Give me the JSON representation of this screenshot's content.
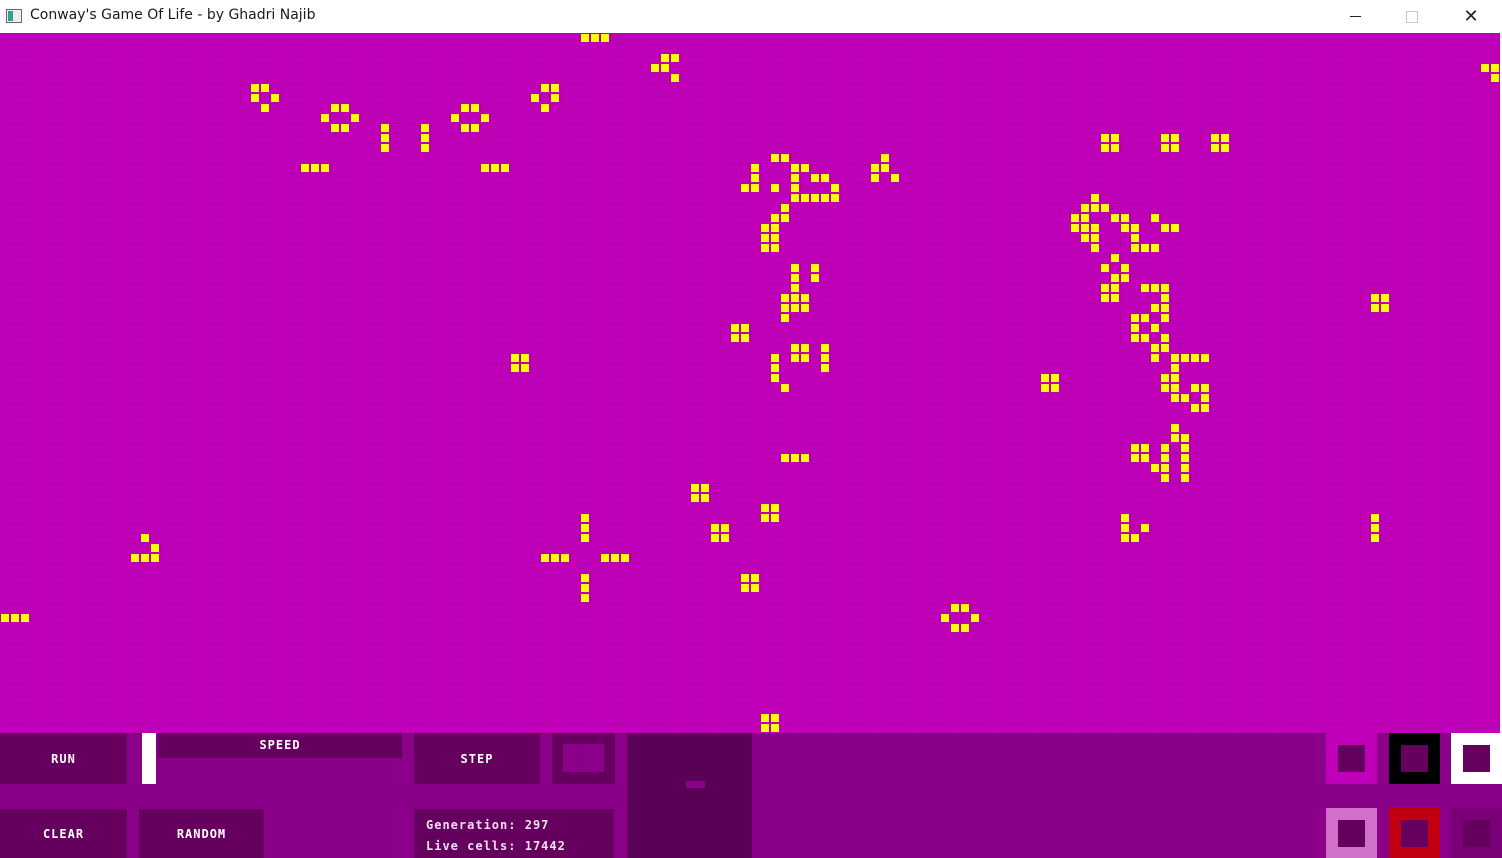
{
  "window": {
    "title": "Conway's Game Of Life - by Ghadri Najib",
    "icon": "app-window-icon",
    "controls": {
      "minimize": "minimize-icon",
      "maximize": "maximize-icon",
      "close": "close-icon"
    }
  },
  "colors": {
    "board_background": "#c000b8",
    "grid_line": "#b400ac",
    "live_cell": "#ffff00",
    "panel_background": "#8a0088",
    "button_background": "#66005e",
    "button_text": "#ffffff"
  },
  "board": {
    "cols": 150,
    "rows": 70,
    "live_cells": [
      [
        0,
        58
      ],
      [
        0,
        59
      ],
      [
        0,
        60
      ],
      [
        3,
        148
      ],
      [
        3,
        149
      ],
      [
        4,
        149
      ],
      [
        2,
        66
      ],
      [
        2,
        67
      ],
      [
        3,
        65
      ],
      [
        3,
        66
      ],
      [
        4,
        67
      ],
      [
        5,
        25
      ],
      [
        5,
        26
      ],
      [
        6,
        25
      ],
      [
        6,
        27
      ],
      [
        7,
        26
      ],
      [
        5,
        54
      ],
      [
        5,
        55
      ],
      [
        6,
        53
      ],
      [
        6,
        55
      ],
      [
        7,
        54
      ],
      [
        7,
        33
      ],
      [
        7,
        34
      ],
      [
        8,
        32
      ],
      [
        8,
        35
      ],
      [
        9,
        33
      ],
      [
        9,
        34
      ],
      [
        7,
        46
      ],
      [
        7,
        47
      ],
      [
        8,
        45
      ],
      [
        8,
        48
      ],
      [
        9,
        46
      ],
      [
        9,
        47
      ],
      [
        9,
        38
      ],
      [
        10,
        38
      ],
      [
        11,
        38
      ],
      [
        9,
        42
      ],
      [
        10,
        42
      ],
      [
        11,
        42
      ],
      [
        13,
        30
      ],
      [
        13,
        31
      ],
      [
        13,
        32
      ],
      [
        13,
        48
      ],
      [
        13,
        49
      ],
      [
        13,
        50
      ],
      [
        10,
        110
      ],
      [
        10,
        111
      ],
      [
        11,
        110
      ],
      [
        11,
        111
      ],
      [
        10,
        116
      ],
      [
        10,
        117
      ],
      [
        11,
        116
      ],
      [
        11,
        117
      ],
      [
        10,
        121
      ],
      [
        10,
        122
      ],
      [
        11,
        121
      ],
      [
        11,
        122
      ],
      [
        12,
        77
      ],
      [
        12,
        78
      ],
      [
        13,
        75
      ],
      [
        13,
        79
      ],
      [
        13,
        80
      ],
      [
        14,
        75
      ],
      [
        14,
        79
      ],
      [
        14,
        81
      ],
      [
        14,
        82
      ],
      [
        15,
        74
      ],
      [
        15,
        75
      ],
      [
        15,
        77
      ],
      [
        15,
        79
      ],
      [
        15,
        83
      ],
      [
        16,
        79
      ],
      [
        16,
        80
      ],
      [
        16,
        81
      ],
      [
        16,
        82
      ],
      [
        16,
        83
      ],
      [
        17,
        78
      ],
      [
        18,
        77
      ],
      [
        18,
        78
      ],
      [
        19,
        76
      ],
      [
        19,
        77
      ],
      [
        20,
        76
      ],
      [
        20,
        77
      ],
      [
        21,
        76
      ],
      [
        21,
        77
      ],
      [
        12,
        88
      ],
      [
        13,
        87
      ],
      [
        13,
        88
      ],
      [
        14,
        87
      ],
      [
        14,
        89
      ],
      [
        16,
        109
      ],
      [
        17,
        108
      ],
      [
        17,
        109
      ],
      [
        17,
        110
      ],
      [
        18,
        107
      ],
      [
        18,
        108
      ],
      [
        18,
        111
      ],
      [
        18,
        112
      ],
      [
        18,
        115
      ],
      [
        19,
        107
      ],
      [
        19,
        108
      ],
      [
        19,
        109
      ],
      [
        19,
        112
      ],
      [
        19,
        113
      ],
      [
        19,
        116
      ],
      [
        19,
        117
      ],
      [
        20,
        108
      ],
      [
        20,
        109
      ],
      [
        20,
        113
      ],
      [
        21,
        109
      ],
      [
        21,
        113
      ],
      [
        21,
        114
      ],
      [
        21,
        115
      ],
      [
        22,
        111
      ],
      [
        23,
        110
      ],
      [
        23,
        112
      ],
      [
        24,
        111
      ],
      [
        24,
        112
      ],
      [
        25,
        110
      ],
      [
        25,
        111
      ],
      [
        25,
        114
      ],
      [
        25,
        115
      ],
      [
        25,
        116
      ],
      [
        26,
        110
      ],
      [
        26,
        111
      ],
      [
        26,
        116
      ],
      [
        27,
        115
      ],
      [
        27,
        116
      ],
      [
        28,
        113
      ],
      [
        28,
        114
      ],
      [
        28,
        116
      ],
      [
        29,
        113
      ],
      [
        29,
        115
      ],
      [
        30,
        113
      ],
      [
        30,
        114
      ],
      [
        30,
        116
      ],
      [
        31,
        115
      ],
      [
        31,
        116
      ],
      [
        32,
        115
      ],
      [
        32,
        117
      ],
      [
        32,
        118
      ],
      [
        32,
        119
      ],
      [
        32,
        120
      ],
      [
        33,
        117
      ],
      [
        34,
        116
      ],
      [
        34,
        117
      ],
      [
        35,
        116
      ],
      [
        35,
        117
      ],
      [
        35,
        119
      ],
      [
        35,
        120
      ],
      [
        36,
        117
      ],
      [
        36,
        118
      ],
      [
        36,
        120
      ],
      [
        37,
        119
      ],
      [
        37,
        120
      ],
      [
        23,
        79
      ],
      [
        23,
        81
      ],
      [
        24,
        79
      ],
      [
        24,
        81
      ],
      [
        25,
        79
      ],
      [
        26,
        78
      ],
      [
        26,
        79
      ],
      [
        26,
        80
      ],
      [
        27,
        78
      ],
      [
        27,
        79
      ],
      [
        27,
        80
      ],
      [
        28,
        78
      ],
      [
        26,
        137
      ],
      [
        26,
        138
      ],
      [
        27,
        137
      ],
      [
        27,
        138
      ],
      [
        29,
        73
      ],
      [
        29,
        74
      ],
      [
        30,
        73
      ],
      [
        30,
        74
      ],
      [
        31,
        79
      ],
      [
        31,
        80
      ],
      [
        31,
        82
      ],
      [
        32,
        77
      ],
      [
        32,
        79
      ],
      [
        32,
        80
      ],
      [
        32,
        82
      ],
      [
        33,
        77
      ],
      [
        33,
        82
      ],
      [
        34,
        77
      ],
      [
        35,
        78
      ],
      [
        32,
        51
      ],
      [
        32,
        52
      ],
      [
        33,
        51
      ],
      [
        33,
        52
      ],
      [
        34,
        104
      ],
      [
        34,
        105
      ],
      [
        35,
        104
      ],
      [
        35,
        105
      ],
      [
        39,
        117
      ],
      [
        40,
        117
      ],
      [
        40,
        118
      ],
      [
        41,
        113
      ],
      [
        41,
        114
      ],
      [
        41,
        116
      ],
      [
        41,
        118
      ],
      [
        42,
        113
      ],
      [
        42,
        114
      ],
      [
        42,
        116
      ],
      [
        42,
        118
      ],
      [
        43,
        115
      ],
      [
        43,
        116
      ],
      [
        43,
        118
      ],
      [
        44,
        116
      ],
      [
        44,
        118
      ],
      [
        42,
        78
      ],
      [
        42,
        79
      ],
      [
        42,
        80
      ],
      [
        45,
        69
      ],
      [
        45,
        70
      ],
      [
        46,
        69
      ],
      [
        46,
        70
      ],
      [
        47,
        76
      ],
      [
        47,
        77
      ],
      [
        48,
        76
      ],
      [
        48,
        77
      ],
      [
        48,
        112
      ],
      [
        49,
        112
      ],
      [
        49,
        114
      ],
      [
        50,
        112
      ],
      [
        50,
        113
      ],
      [
        48,
        137
      ],
      [
        49,
        137
      ],
      [
        50,
        137
      ],
      [
        48,
        58
      ],
      [
        49,
        58
      ],
      [
        50,
        58
      ],
      [
        49,
        71
      ],
      [
        49,
        72
      ],
      [
        50,
        71
      ],
      [
        50,
        72
      ],
      [
        50,
        14
      ],
      [
        51,
        15
      ],
      [
        52,
        13
      ],
      [
        52,
        14
      ],
      [
        52,
        15
      ],
      [
        52,
        54
      ],
      [
        52,
        55
      ],
      [
        52,
        56
      ],
      [
        52,
        60
      ],
      [
        52,
        61
      ],
      [
        52,
        62
      ],
      [
        54,
        58
      ],
      [
        55,
        58
      ],
      [
        56,
        58
      ],
      [
        54,
        74
      ],
      [
        54,
        75
      ],
      [
        55,
        74
      ],
      [
        55,
        75
      ],
      [
        57,
        95
      ],
      [
        57,
        96
      ],
      [
        58,
        94
      ],
      [
        58,
        97
      ],
      [
        59,
        95
      ],
      [
        59,
        96
      ],
      [
        58,
        0
      ],
      [
        58,
        1
      ],
      [
        58,
        2
      ],
      [
        68,
        76
      ],
      [
        68,
        77
      ],
      [
        69,
        76
      ],
      [
        69,
        77
      ]
    ]
  },
  "controls": {
    "run": "RUN",
    "speed": "SPEED",
    "step": "STEP",
    "clear": "CLEAR",
    "random": "RANDOM"
  },
  "stats": {
    "generation_label": "Generation:",
    "generation": "297",
    "live_cells_label": "Live cells:",
    "live_cells": "17442"
  },
  "palettes": [
    {
      "name": "palette-magenta-light",
      "outer": "#c000b8",
      "inner": "#66005e"
    },
    {
      "name": "palette-black",
      "outer": "#000000",
      "inner": "#66005e"
    },
    {
      "name": "palette-white",
      "outer": "#ffffff",
      "inner": "#66005e"
    },
    {
      "name": "palette-pink",
      "outer": "#d070c8",
      "inner": "#66005e"
    },
    {
      "name": "palette-red",
      "outer": "#c00010",
      "inner": "#66005e"
    },
    {
      "name": "palette-purple",
      "outer": "#7a0078",
      "inner": "#66005e"
    }
  ]
}
